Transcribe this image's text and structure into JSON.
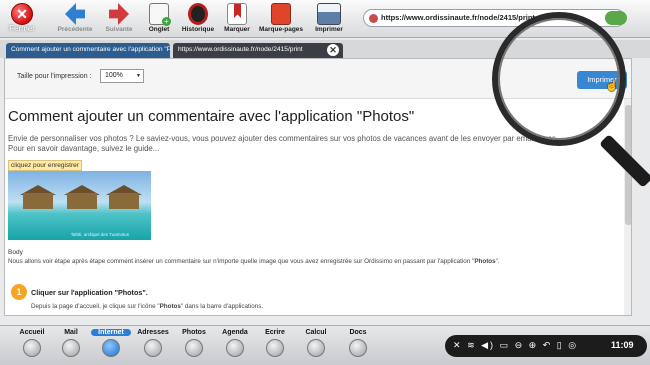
{
  "toolbar": {
    "close": "Fermer",
    "buttons": [
      {
        "label": "Précédente",
        "icon": "arrow-left-icon",
        "color": "#2f7fd1",
        "enabled": false
      },
      {
        "label": "Suivante",
        "icon": "arrow-right-icon",
        "color": "#d33b3b",
        "enabled": false
      },
      {
        "label": "Onglet",
        "icon": "new-tab-icon",
        "color": "#f2f2f2",
        "enabled": true
      },
      {
        "label": "Historique",
        "icon": "history-icon",
        "color": "#b51f1f",
        "enabled": true
      },
      {
        "label": "Marquer",
        "icon": "bookmark-icon",
        "color": "#c62828",
        "enabled": true
      },
      {
        "label": "Marque-pages",
        "icon": "bookmarks-icon",
        "color": "#e0452c",
        "enabled": true
      },
      {
        "label": "Imprimer",
        "icon": "printer-icon",
        "color": "#5b7fa6",
        "enabled": true
      }
    ],
    "url": "https://www.ordissinaute.fr/node/2415/print"
  },
  "tabs": [
    {
      "label": "Comment ajouter un commentaire avec l'application \"Ph..."
    },
    {
      "label": "https://www.ordissinaute.fr/node/2415/print"
    }
  ],
  "print": {
    "size_label": "Taille pour l'impression :",
    "size_value": "100%",
    "print_button": "Imprimer"
  },
  "article": {
    "title": "Comment ajouter un commentaire avec l'application \"Photos\"",
    "intro_line1": "Envie de personnaliser vos photos ? Le saviez-vous, vous pouvez ajouter des commentaires sur vos photos de vacances avant de les envoyer par email à vos",
    "intro_line2": "Pour en savoir davantage, suivez le guide...",
    "save_tip": "cliquez pour enregistrer",
    "photo_credit": "Tahiti, archipel des Tuamotus",
    "body_label": "Body",
    "steps_intro_before": "Nous allons voir étape après étape comment insérer un commentaire sur n'importe quelle image que vous avez enregistrée sur Ordissimo en passant par l'application \"",
    "steps_intro_bold": "Photos",
    "steps_intro_after": "\".",
    "step1_number": "1",
    "step1_title": "Cliquer sur l'application \"Photos\".",
    "step1_text_before": "Depuis la page d'accueil, je clique sur l'icône \"",
    "step1_text_bold": "Photos",
    "step1_text_after": "\" dans la barre d'applications."
  },
  "dock": {
    "items": [
      {
        "label": "Accueil",
        "active": false,
        "icon": "home-icon"
      },
      {
        "label": "Mail",
        "active": false,
        "icon": "mail-icon"
      },
      {
        "label": "Internet",
        "active": true,
        "icon": "globe-icon"
      },
      {
        "label": "Adresses",
        "active": false,
        "icon": "contacts-icon"
      },
      {
        "label": "Photos",
        "active": false,
        "icon": "photos-icon"
      },
      {
        "label": "Agenda",
        "active": false,
        "icon": "calendar-icon"
      },
      {
        "label": "Ecrire",
        "active": false,
        "icon": "write-icon"
      },
      {
        "label": "Calcul",
        "active": false,
        "icon": "calculator-icon"
      },
      {
        "label": "Docs",
        "active": false,
        "icon": "documents-icon"
      }
    ],
    "time": "11:09"
  }
}
